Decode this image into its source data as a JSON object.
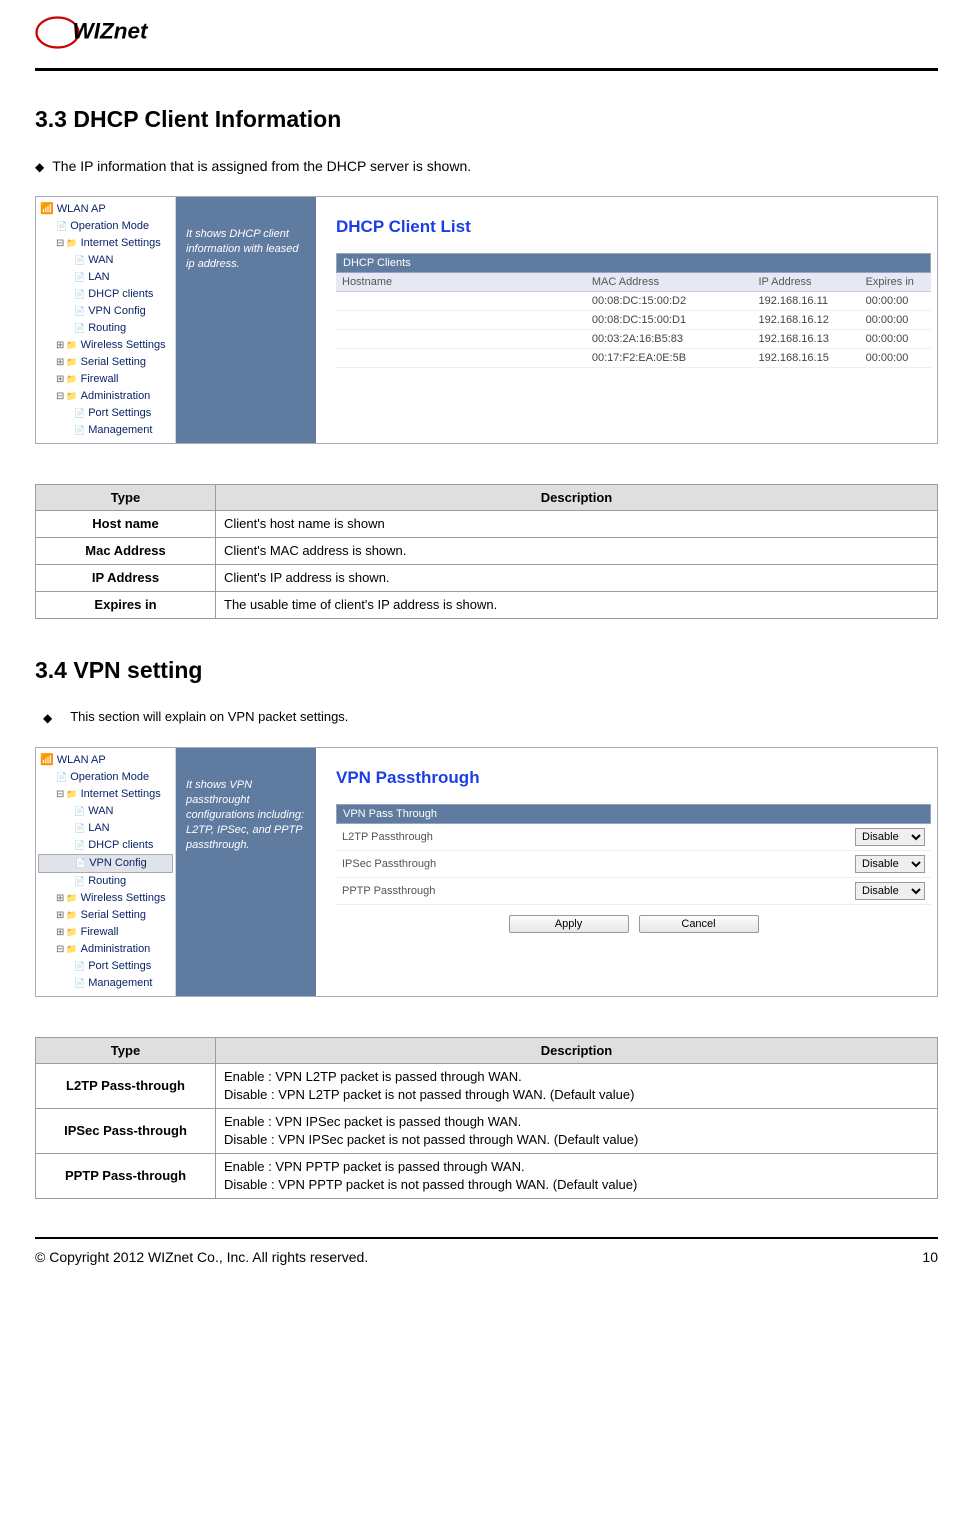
{
  "logo_text": "WIZnet",
  "headings": {
    "s33": "3.3  DHCP Client Information",
    "s34": "3.4  VPN setting"
  },
  "intros": {
    "s33": "The IP information that is assigned from the DHCP server is shown.",
    "s34": "This section will explain on VPN packet settings."
  },
  "nav_tree": {
    "root": "WLAN AP",
    "operation_mode": "Operation Mode",
    "internet_settings": "Internet Settings",
    "wan": "WAN",
    "lan": "LAN",
    "dhcp_clients": "DHCP clients",
    "vpn_config": "VPN Config",
    "routing": "Routing",
    "wireless_settings": "Wireless Settings",
    "serial_setting": "Serial Setting",
    "firewall": "Firewall",
    "administration": "Administration",
    "port_settings": "Port Settings",
    "management": "Management"
  },
  "screenshot1": {
    "desc": "It shows DHCP client information with leased ip address.",
    "title": "DHCP Client List",
    "section_bar": "DHCP Clients",
    "columns": {
      "host": "Hostname",
      "mac": "MAC Address",
      "ip": "IP Address",
      "exp": "Expires in"
    },
    "rows": [
      {
        "host": "",
        "mac": "00:08:DC:15:00:D2",
        "ip": "192.168.16.11",
        "exp": "00:00:00"
      },
      {
        "host": "",
        "mac": "00:08:DC:15:00:D1",
        "ip": "192.168.16.12",
        "exp": "00:00:00"
      },
      {
        "host": "",
        "mac": "00:03:2A:16:B5:83",
        "ip": "192.168.16.13",
        "exp": "00:00:00"
      },
      {
        "host": "",
        "mac": "00:17:F2:EA:0E:5B",
        "ip": "192.168.16.15",
        "exp": "00:00:00"
      }
    ]
  },
  "info1": {
    "header_type": "Type",
    "header_desc": "Description",
    "rows": [
      {
        "type": "Host name",
        "desc": "Client's host name is shown"
      },
      {
        "type": "Mac Address",
        "desc": "Client's MAC address is shown."
      },
      {
        "type": "IP Address",
        "desc": "Client's IP address is shown."
      },
      {
        "type": "Expires in",
        "desc": "The usable time of client's IP address is shown."
      }
    ]
  },
  "screenshot2": {
    "desc": "It shows VPN passthrought configurations including: L2TP, IPSec, and PPTP passthrough.",
    "title": "VPN Passthrough",
    "section_bar": "VPN Pass Through",
    "rows": [
      {
        "label": "L2TP Passthrough",
        "value": "Disable"
      },
      {
        "label": "IPSec Passthrough",
        "value": "Disable"
      },
      {
        "label": "PPTP Passthrough",
        "value": "Disable"
      }
    ],
    "apply": "Apply",
    "cancel": "Cancel"
  },
  "info2": {
    "header_type": "Type",
    "header_desc": "Description",
    "rows": [
      {
        "type": "L2TP Pass-through",
        "l1": "Enable : VPN L2TP packet is passed through WAN.",
        "l2": "Disable : VPN L2TP packet is not passed through WAN. (Default value)"
      },
      {
        "type": "IPSec Pass-through",
        "l1": "Enable : VPN IPSec packet is passed though WAN.",
        "l2": "Disable : VPN IPSec packet is not passed through WAN. (Default value)"
      },
      {
        "type": "PPTP Pass-through",
        "l1": "Enable : VPN PPTP packet is passed through WAN.",
        "l2": "Disable : VPN PPTP packet is not passed through WAN. (Default value)"
      }
    ]
  },
  "footer": {
    "copyright": "© Copyright 2012 WIZnet Co., Inc. All rights reserved.",
    "page": "10"
  }
}
